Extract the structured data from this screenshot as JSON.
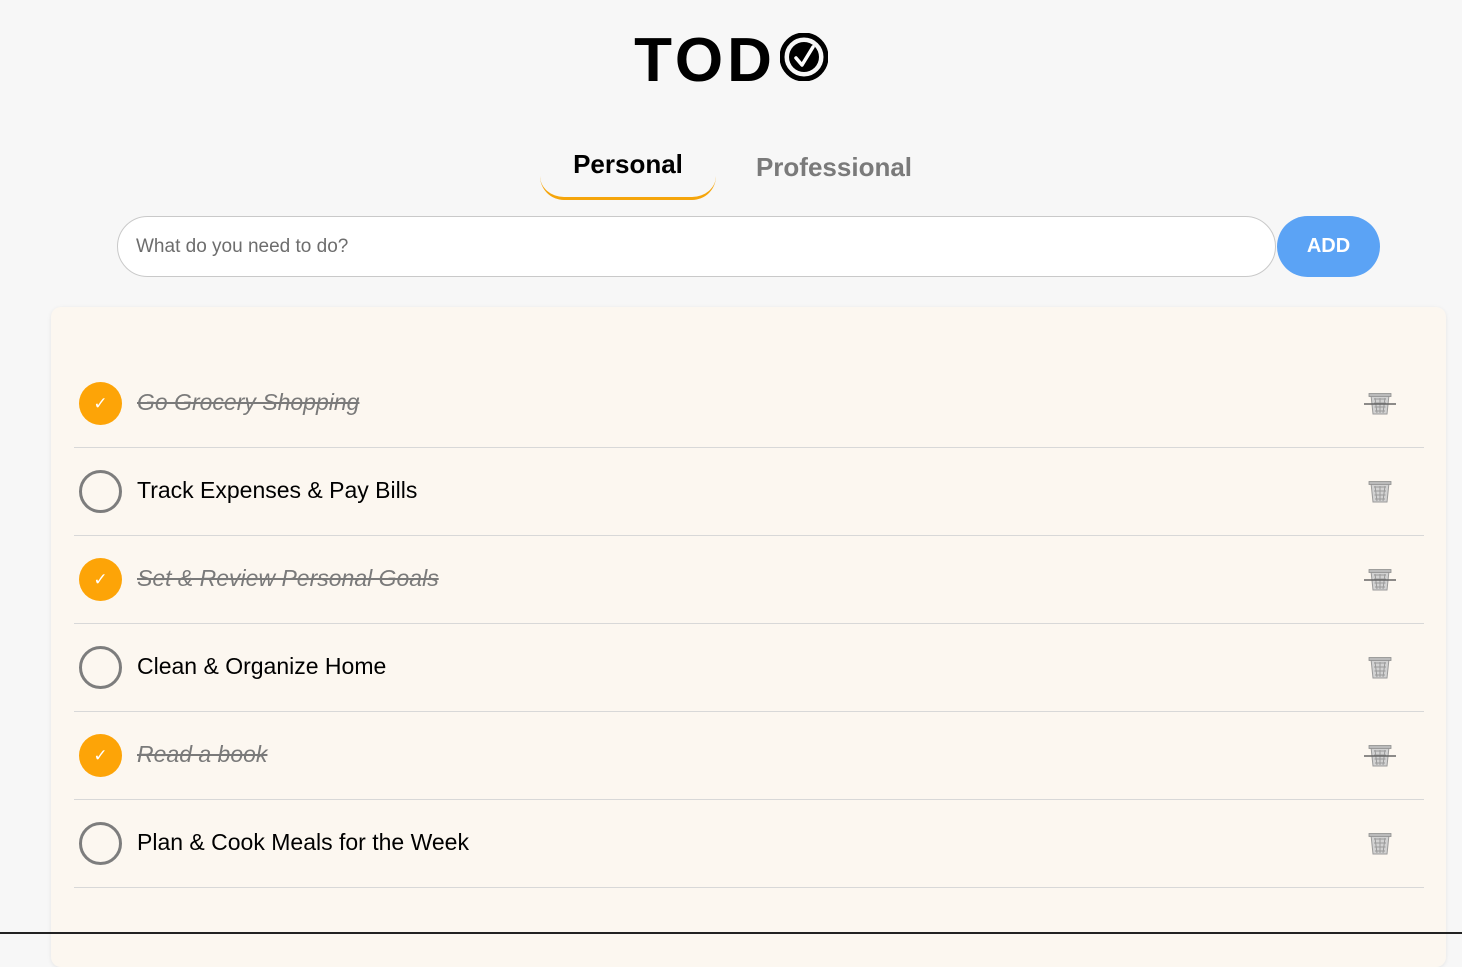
{
  "app": {
    "title": "TOD",
    "logo_icon": "check-circle-icon"
  },
  "tabs": [
    {
      "label": "Personal",
      "active": true
    },
    {
      "label": "Professional",
      "active": false
    }
  ],
  "input": {
    "placeholder": "What do you need to do?",
    "value": ""
  },
  "add_button": {
    "label": "ADD"
  },
  "tasks": [
    {
      "text": "Go Grocery Shopping",
      "completed": true
    },
    {
      "text": "Track Expenses & Pay Bills",
      "completed": false
    },
    {
      "text": "Set & Review Personal Goals",
      "completed": true
    },
    {
      "text": "Clean & Organize Home",
      "completed": false
    },
    {
      "text": "Read a book",
      "completed": true
    },
    {
      "text": "Plan & Cook Meals for the Week",
      "completed": false
    }
  ],
  "icons": {
    "check": "checkmark-icon",
    "delete": "trash-icon"
  },
  "colors": {
    "accent": "#fda407",
    "add_button": "#5ba3f5",
    "card_background": "#fcf7f0",
    "page_background": "#f7f7f7"
  }
}
